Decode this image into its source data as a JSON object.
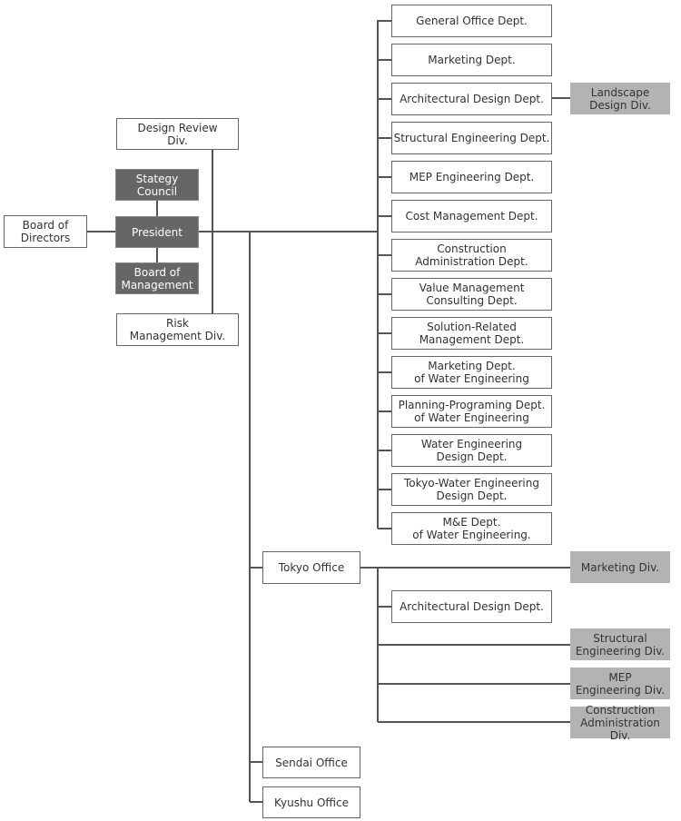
{
  "colors": {
    "line": "#555555",
    "dark_box": "#666666",
    "gray_box": "#b3b3b3",
    "white_box_border": "#666666"
  },
  "top": {
    "board_of_directors": "Board of\nDirectors",
    "design_review": "Design Review\nDiv.",
    "strategy_council": "Stategy\nCouncil",
    "president": "President",
    "board_of_management": "Board of\nManagement",
    "risk_management": "Risk\nManagement Div."
  },
  "departments": [
    "General Office Dept.",
    "Marketing Dept.",
    "Architectural Design Dept.",
    "Structural Engineering Dept.",
    "MEP Engineering Dept.",
    "Cost Management Dept.",
    "Construction\nAdministration Dept.",
    "Value Management\nConsulting Dept.",
    "Solution-Related\nManagement Dept.",
    "Marketing Dept.\nof Water Engineering",
    "Planning-Programing Dept.\nof Water Engineering",
    "Water Engineering\nDesign Dept.",
    "Tokyo-Water Engineering\nDesign Dept.",
    "M&E Dept.\nof Water Engineering."
  ],
  "landscape": "Landscape\nDesign Div.",
  "offices": {
    "tokyo": "Tokyo Office",
    "sendai": "Sendai Office",
    "kyushu": "Kyushu Office"
  },
  "tokyo_units": {
    "marketing": "Marketing Div.",
    "architectural": "Architectural Design Dept.",
    "structural": "Structural\nEngineering Div.",
    "mep": "MEP\nEngineering Div.",
    "construction": "Construction\nAdministration Div."
  }
}
